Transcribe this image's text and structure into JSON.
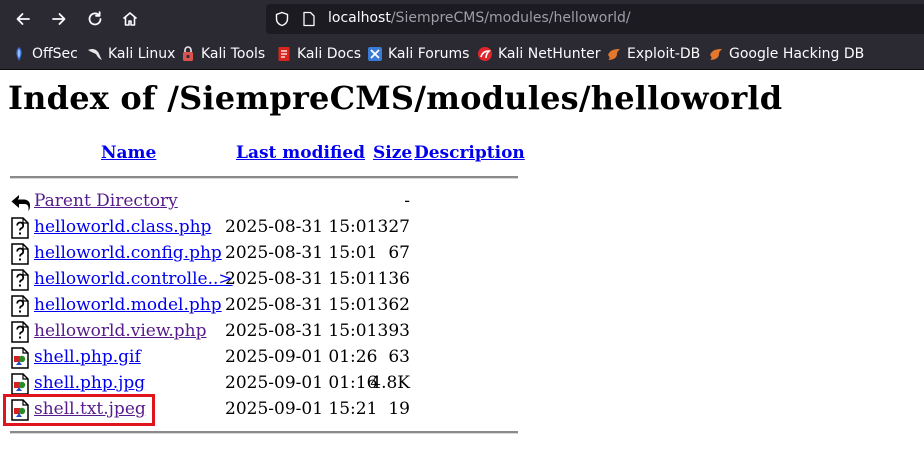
{
  "browser": {
    "url_host": "localhost",
    "url_path": "/SiempreCMS/modules/helloworld/",
    "bookmarks": [
      {
        "label": "OffSec",
        "icon": "offsec-icon",
        "color": "#3b6fd8"
      },
      {
        "label": "Kali Linux",
        "icon": "kali-dragon-icon",
        "color": "#e8e8e8"
      },
      {
        "label": "Kali Tools",
        "icon": "kali-tools-icon",
        "color": "#d9534f"
      },
      {
        "label": "Kali Docs",
        "icon": "kali-docs-icon",
        "color": "#d9251c"
      },
      {
        "label": "Kali Forums",
        "icon": "kali-forums-icon",
        "color": "#3a7bd5"
      },
      {
        "label": "Kali NetHunter",
        "icon": "kali-nethunter-icon",
        "color": "#e0262a"
      },
      {
        "label": "Exploit-DB",
        "icon": "exploit-db-icon",
        "color": "#e3782c"
      },
      {
        "label": "Google Hacking DB",
        "icon": "ghdb-icon",
        "color": "#e3782c"
      }
    ]
  },
  "page": {
    "title": "Index of /SiempreCMS/modules/helloworld",
    "columns": {
      "name": "Name",
      "last_modified": "Last modified",
      "size": "Size",
      "description": "Description"
    },
    "entries": [
      {
        "name": "Parent Directory",
        "date": "",
        "size": "-",
        "icon": "back-arrow-icon",
        "visited": true
      },
      {
        "name": "helloworld.class.php",
        "date": "2025-08-31 15:01",
        "size": "327",
        "icon": "unknown-file-icon",
        "visited": false
      },
      {
        "name": "helloworld.config.php",
        "date": "2025-08-31 15:01",
        "size": "67",
        "icon": "unknown-file-icon",
        "visited": false
      },
      {
        "name": "helloworld.controlle..>",
        "date": "2025-08-31 15:01",
        "size": "136",
        "icon": "unknown-file-icon",
        "visited": false
      },
      {
        "name": "helloworld.model.php",
        "date": "2025-08-31 15:01",
        "size": "362",
        "icon": "unknown-file-icon",
        "visited": false
      },
      {
        "name": "helloworld.view.php",
        "date": "2025-08-31 15:01",
        "size": "393",
        "icon": "unknown-file-icon",
        "visited": true
      },
      {
        "name": "shell.php.gif",
        "date": "2025-09-01 01:26",
        "size": "63",
        "icon": "image-file-icon",
        "visited": false
      },
      {
        "name": "shell.php.jpg",
        "date": "2025-09-01 01:16",
        "size": "4.8K",
        "icon": "image-file-icon",
        "visited": false
      },
      {
        "name": "shell.txt.jpeg",
        "date": "2025-09-01 15:21",
        "size": "19",
        "icon": "image-file-icon",
        "visited": true
      }
    ]
  },
  "annotation": {
    "color": "#e0141c"
  }
}
